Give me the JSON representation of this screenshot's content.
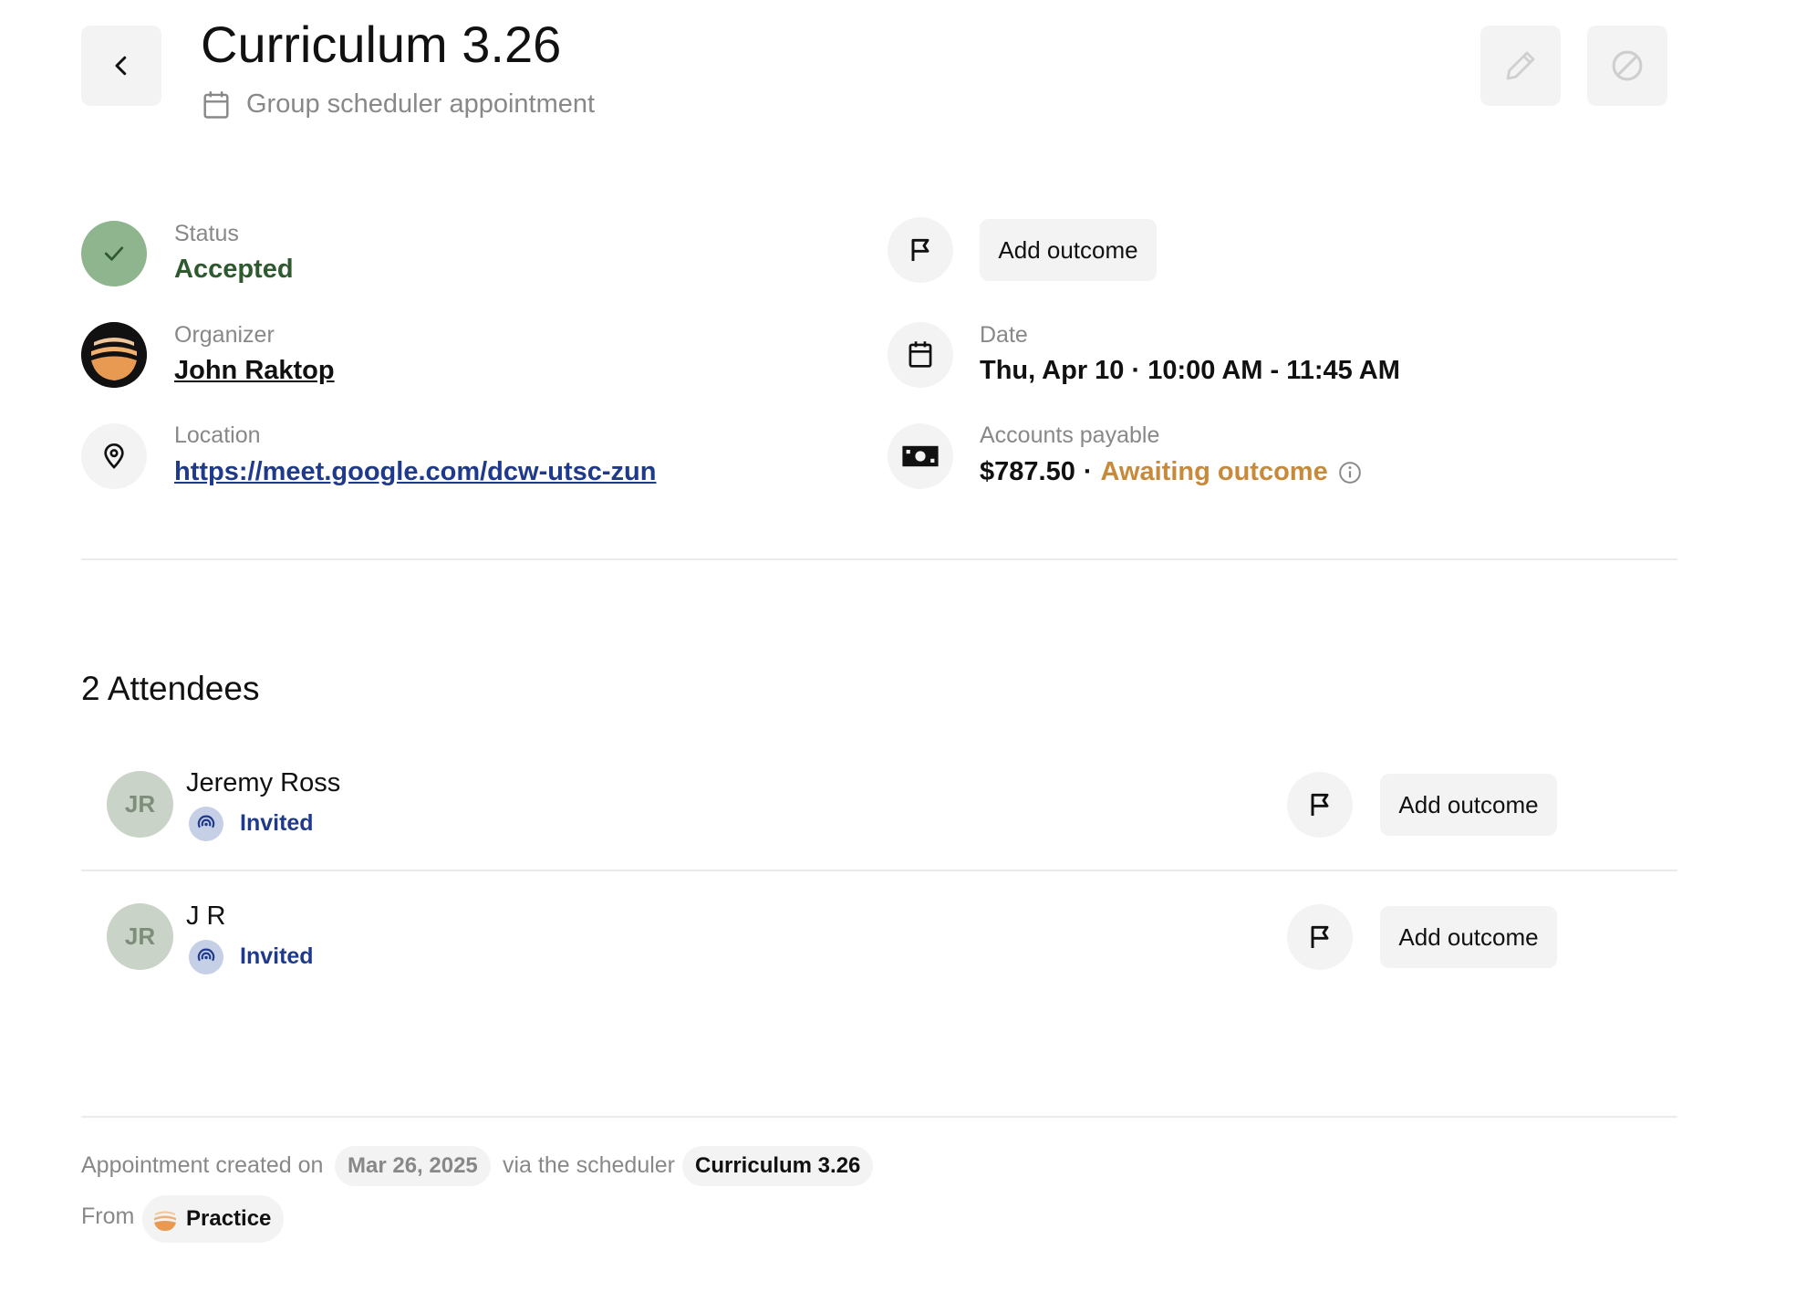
{
  "header": {
    "title": "Curriculum 3.26",
    "subtitle": "Group scheduler appointment"
  },
  "details": {
    "status": {
      "label": "Status",
      "value": "Accepted",
      "color": "#2f5a2f"
    },
    "organizer": {
      "label": "Organizer",
      "value": "John Raktop"
    },
    "location": {
      "label": "Location",
      "value": "https://meet.google.com/dcw-utsc-zun"
    },
    "outcome_button": "Add outcome",
    "date": {
      "label": "Date",
      "value": "Thu, Apr 10 · 10:00 AM - 11:45 AM"
    },
    "accounts_payable": {
      "label": "Accounts payable",
      "amount": "$787.50",
      "separator": "·",
      "status": "Awaiting outcome",
      "status_color": "#c78a3a"
    }
  },
  "attendees": {
    "heading": "2 Attendees",
    "items": [
      {
        "initials": "JR",
        "name": "Jeremy Ross",
        "status": "Invited",
        "button": "Add outcome"
      },
      {
        "initials": "JR",
        "name": "J R",
        "status": "Invited",
        "button": "Add outcome"
      }
    ]
  },
  "footer": {
    "created_prefix": "Appointment created on",
    "created_date": "Mar 26, 2025",
    "via_text": "via the scheduler",
    "scheduler_name": "Curriculum 3.26",
    "from_text": "From",
    "from_name": "Practice"
  }
}
